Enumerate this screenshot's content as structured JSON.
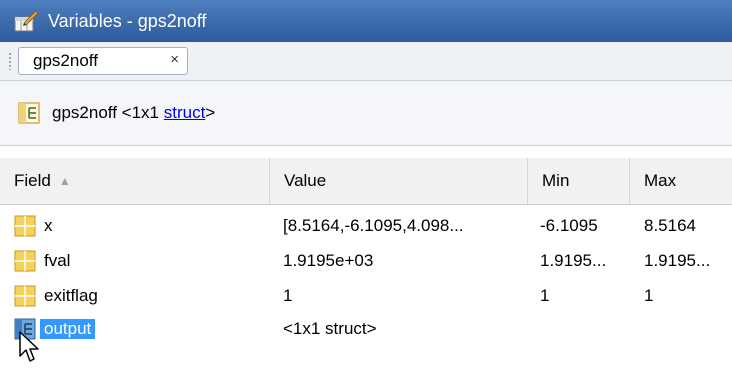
{
  "window": {
    "title": "Variables - gps2noff"
  },
  "tab": {
    "label": "gps2noff",
    "close_glyph": "×"
  },
  "path": {
    "name": "gps2noff",
    "size": "<1x1",
    "link_text": "struct",
    "suffix": ">"
  },
  "columns": {
    "field": "Field",
    "value": "Value",
    "min": "Min",
    "max": "Max"
  },
  "rows": [
    {
      "field": "x",
      "value": "[8.5164,-6.1095,4.098...",
      "min": "-6.1095",
      "max": "8.5164",
      "icon": "matrix-icon"
    },
    {
      "field": "fval",
      "value": "1.9195e+03",
      "min": "1.9195...",
      "max": "1.9195...",
      "icon": "matrix-icon"
    },
    {
      "field": "exitflag",
      "value": "1",
      "min": "1",
      "max": "1",
      "icon": "matrix-icon"
    },
    {
      "field": "output",
      "value": "<1x1 struct>",
      "min": "",
      "max": "",
      "icon": "struct-icon",
      "selected": true
    }
  ],
  "colors": {
    "title_bar": "#2c5a9c",
    "selection": "#3399ff",
    "link": "#0000ee"
  }
}
